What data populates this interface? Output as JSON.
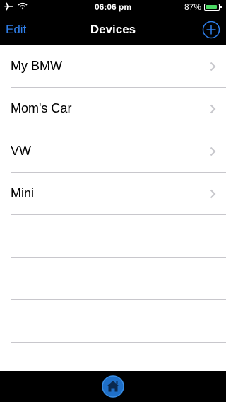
{
  "status_bar": {
    "time": "06:06 pm",
    "battery_percent_label": "87%",
    "battery_level": 0.87,
    "battery_color": "#4cd964",
    "icons": [
      "airplane-icon",
      "wifi-icon",
      "battery-icon"
    ]
  },
  "nav": {
    "edit_label": "Edit",
    "title": "Devices",
    "add_icon": "plus-circle-icon",
    "accent_color": "#2f7fea"
  },
  "devices": [
    {
      "name": "My BMW"
    },
    {
      "name": "Mom's Car"
    },
    {
      "name": "VW"
    },
    {
      "name": "Mini"
    }
  ],
  "empty_rows": 4,
  "tab_bar": {
    "home_icon": "home-icon"
  }
}
